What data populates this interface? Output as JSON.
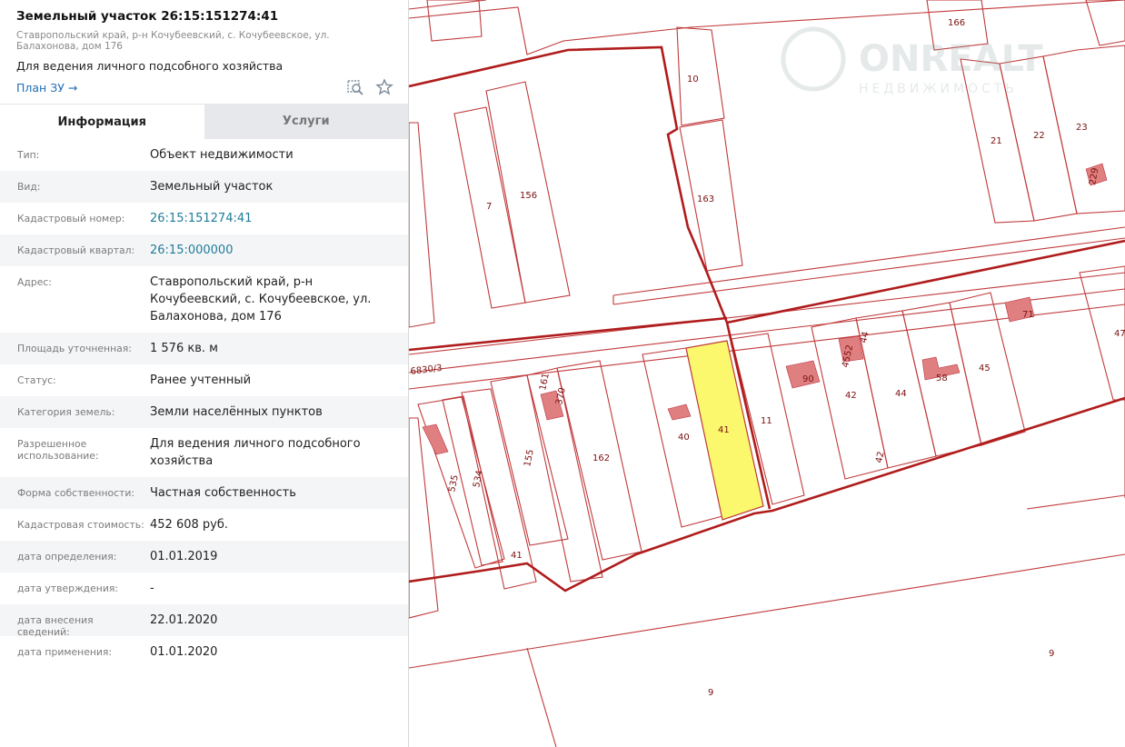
{
  "header": {
    "title": "Земельный участок 26:15:151274:41",
    "address": "Ставропольский край, р-н Кочубеевский, с. Кочубеевское, ул. Балахонова, дом 176",
    "purpose": "Для ведения личного подсобного хозяйства",
    "plan_link": "План ЗУ →"
  },
  "tabs": [
    {
      "label": "Информация",
      "active": true
    },
    {
      "label": "Услуги",
      "active": false
    }
  ],
  "rows": [
    {
      "key": "Тип:",
      "value": "Объект недвижимости"
    },
    {
      "key": "Вид:",
      "value": "Земельный участок"
    },
    {
      "key": "Кадастровый номер:",
      "value": "26:15:151274:41",
      "link": true
    },
    {
      "key": "Кадастровый квартал:",
      "value": "26:15:000000",
      "link": true
    },
    {
      "key": "Адрес:",
      "value": "Ставропольский край, р-н Кочубеевский, с. Кочубеевское, ул. Балахонова, дом 176"
    },
    {
      "key": "Площадь уточненная:",
      "value": "1 576 кв. м"
    },
    {
      "key": "Статус:",
      "value": "Ранее учтенный"
    },
    {
      "key": "Категория земель:",
      "value": "Земли населённых пунктов"
    },
    {
      "key": "Разрешенное использование:",
      "value": "Для ведения личного подсобного хозяйства"
    },
    {
      "key": "Форма собственности:",
      "value": "Частная собственность"
    },
    {
      "key": "Кадастровая стоимость:",
      "value": "452 608 руб."
    },
    {
      "key": "дата определения:",
      "value": "01.01.2019"
    },
    {
      "key": "дата утверждения:",
      "value": "-"
    },
    {
      "key": "дата внесения сведений:",
      "value": "22.01.2020"
    },
    {
      "key": "дата применения:",
      "value": "01.01.2020"
    }
  ],
  "map": {
    "parcel_labels": [
      "166",
      "10",
      "21",
      "22",
      "23",
      "229",
      "163",
      "7",
      "156",
      "71",
      "47",
      "44",
      "4552",
      "90",
      "42",
      "44",
      "58",
      "45",
      "42",
      "161",
      "370",
      "40",
      "41",
      "11",
      "162",
      "155",
      "534",
      "535",
      "41",
      "9",
      "9"
    ],
    "road_label": "6830/3",
    "watermark": "ONREALT НЕДВИЖИМОСТЬ",
    "colors": {
      "boundary": "#b01c1c",
      "parcel_line": "#c0393b",
      "selected_fill": "#fbf86e",
      "building_fill": "#e07f80"
    }
  },
  "icons": [
    "search-map-icon",
    "star-icon",
    "arrow-right-icon"
  ]
}
